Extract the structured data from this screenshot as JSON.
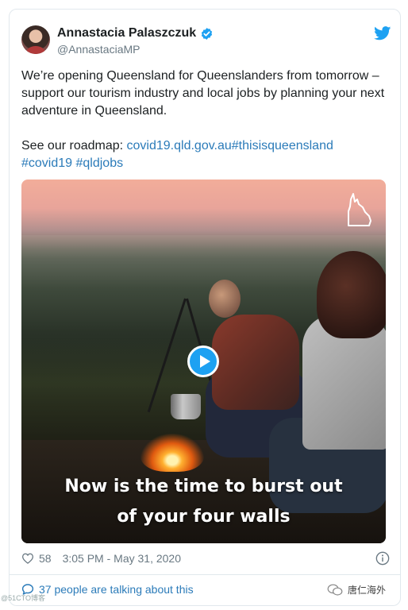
{
  "tweet": {
    "display_name": "Annastacia Palaszczuk",
    "handle": "@AnnastaciaMP",
    "text_line1": "We’re opening Queensland for Queenslanders from tomorrow –",
    "text_line2": "support our tourism industry and local jobs by planning your next",
    "text_line3": "adventure in Queensland.",
    "roadmap_prefix": "See our roadmap: ",
    "roadmap_link": "covid19.qld.gov.au",
    "hashtag_thisisqueensland": "#thisisqueensland",
    "hashtag_covid19": "#covid19",
    "hashtag_qldjobs": "#qldjobs"
  },
  "media": {
    "caption_line1": "Now is the time to burst out",
    "caption_line2": "of your four walls"
  },
  "footer": {
    "like_count": "58",
    "timestamp": "3:05 PM - May 31, 2020",
    "talking_text": "37 people are talking about this"
  },
  "watermark": {
    "left_text": "@51CTO博客",
    "right_text": "唐仁海外"
  },
  "colors": {
    "link": "#2b7bb9",
    "twitter_blue": "#1da1f2",
    "muted_text": "#697882",
    "border": "#e1e8ed"
  },
  "icons": [
    "verified-badge-icon",
    "twitter-bird-icon",
    "play-icon",
    "heart-icon",
    "info-icon",
    "speech-bubble-icon",
    "queensland-outline-icon",
    "wechat-icon"
  ]
}
